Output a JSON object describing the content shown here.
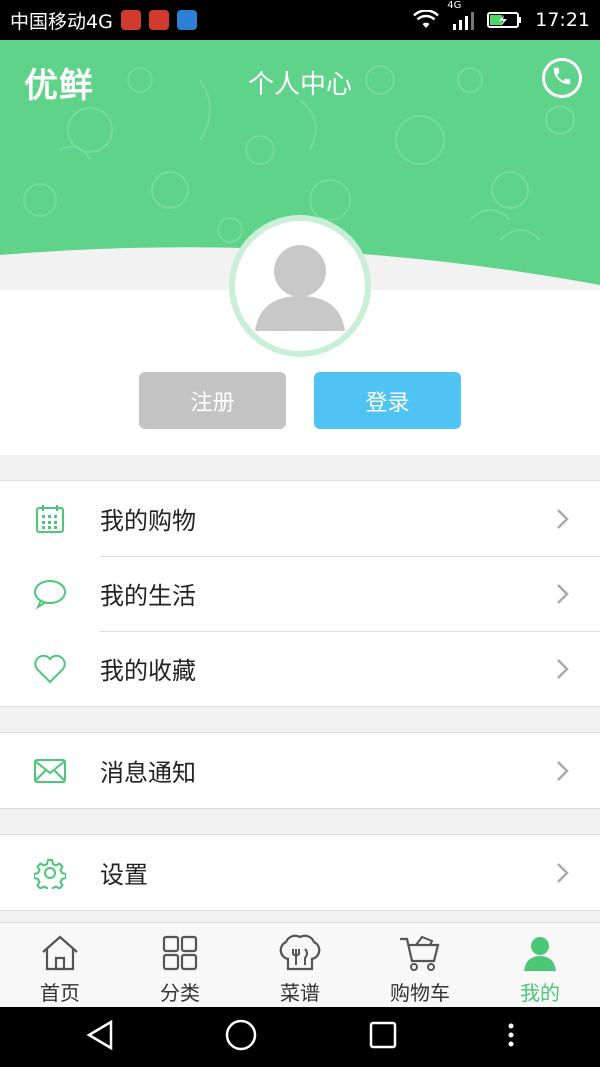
{
  "status_bar": {
    "carrier": "中国移动4G",
    "network_type": "4G",
    "time": "17:21"
  },
  "header": {
    "brand": "优鲜",
    "title": "个人中心",
    "phone_icon": "phone-icon"
  },
  "auth": {
    "register_label": "注册",
    "login_label": "登录"
  },
  "menu": {
    "shopping": "我的购物",
    "life": "我的生活",
    "favorites": "我的收藏",
    "messages": "消息通知",
    "settings": "设置"
  },
  "tabs": [
    {
      "label": "首页",
      "icon": "home-icon"
    },
    {
      "label": "分类",
      "icon": "category-grid-icon"
    },
    {
      "label": "菜谱",
      "icon": "chef-hat-icon"
    },
    {
      "label": "购物车",
      "icon": "cart-icon"
    },
    {
      "label": "我的",
      "icon": "profile-icon",
      "active": true
    }
  ],
  "colors": {
    "brand_green": "#5fd38a",
    "accent_green": "#4cc777",
    "login_blue": "#4fc4f3",
    "register_gray": "#c3c3c3"
  }
}
